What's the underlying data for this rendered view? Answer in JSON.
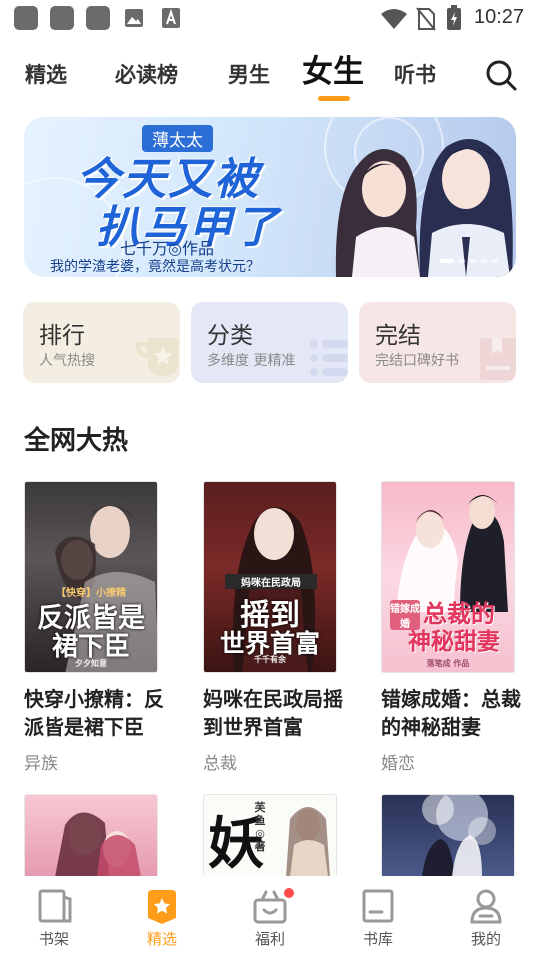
{
  "status_bar": {
    "time": "10:27"
  },
  "tabs": [
    {
      "label": "精选"
    },
    {
      "label": "必读榜"
    },
    {
      "label": "男生"
    },
    {
      "label": "女生",
      "active": true
    },
    {
      "label": "听书"
    }
  ],
  "banner": {
    "tag": "薄太太",
    "title_line1": "今天又被",
    "title_line2": "扒马甲了",
    "author": "七千万◎作品",
    "subtitle": "我的学渣老婆，竟然是高考状元？",
    "dot_count": 5,
    "active_dot": 0
  },
  "quick_cards": [
    {
      "title": "排行",
      "subtitle": "人气热搜",
      "bg": "#f3eee1",
      "icon": "trophy-icon"
    },
    {
      "title": "分类",
      "subtitle": "多维度 更精准",
      "bg": "#e4e8f6",
      "icon": "list-icon"
    },
    {
      "title": "完结",
      "subtitle": "完结口碑好书",
      "bg": "#f6e6e6",
      "icon": "book-icon"
    }
  ],
  "section": {
    "title": "全网大热"
  },
  "books": [
    {
      "title": "快穿小撩精：反派皆是裙下臣",
      "tag": "异族",
      "cover_small": "【快穿】小撩精",
      "cover_big1": "反派皆是",
      "cover_big2": "裙下臣",
      "cover_author": "夕夕知意"
    },
    {
      "title": "妈咪在民政局摇到世界首富",
      "tag": "总裁",
      "cover_small": "妈咪在民政局",
      "cover_big1": "摇到",
      "cover_big2": "世界首富",
      "cover_author": "千千有余"
    },
    {
      "title": "错嫁成婚：总裁的神秘甜妻",
      "tag": "婚恋",
      "cover_small": "错嫁成婚",
      "cover_big1": "总裁的",
      "cover_big2": "神秘甜妻",
      "cover_author": "落笔成 作品"
    }
  ],
  "books_row2_cover_text": {
    "title": "妖",
    "small": "芙鱼◎著"
  },
  "bottom_nav": [
    {
      "label": "书架",
      "icon": "bookshelf-icon"
    },
    {
      "label": "精选",
      "icon": "featured-icon",
      "active": true
    },
    {
      "label": "福利",
      "icon": "gift-icon",
      "badge": true
    },
    {
      "label": "书库",
      "icon": "library-icon"
    },
    {
      "label": "我的",
      "icon": "profile-icon"
    }
  ],
  "colors": {
    "accent": "#ff9c1a",
    "badge": "#ff4b4b"
  }
}
